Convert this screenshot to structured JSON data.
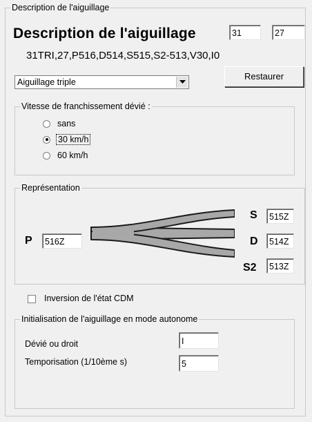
{
  "panel": {
    "legend": "Description de l'aiguillage"
  },
  "header": {
    "title": "Description de l'aiguillage",
    "field_1": "31",
    "field_2": "27",
    "code_line": "31TRI,27,P516,D514,S515,S2-513,V30,I0"
  },
  "type_select": {
    "value": "Aiguillage triple"
  },
  "restore_button": {
    "label": "Restaurer"
  },
  "speed_group": {
    "legend": "Vitesse de franchissement dévié :",
    "options": [
      {
        "label": "sans",
        "checked": false
      },
      {
        "label": "30 km/h",
        "checked": true
      },
      {
        "label": "60 km/h",
        "checked": false
      }
    ]
  },
  "representation": {
    "legend": "Représentation",
    "p_label": "P",
    "p_value": "516Z",
    "s_label": "S",
    "s_value": "515Z",
    "d_label": "D",
    "d_value": "514Z",
    "s2_label": "S2",
    "s2_value": "513Z"
  },
  "inversion": {
    "label": "Inversion de l'état CDM",
    "checked": false
  },
  "autonomous": {
    "legend": "Initialisation de l'aiguillage en mode autonome",
    "devie_label": "Dévié ou droit",
    "devie_value": "I",
    "tempo_label": "Temporisation  (1/10ème s)",
    "tempo_value": "5"
  },
  "icons": {
    "dropdown": "chevron-down-icon",
    "switch": "triple-switch-diagram"
  },
  "colors": {
    "background": "#f0f0f0",
    "track_fill": "#a8a8a8",
    "track_outline": "#1a1a1a"
  }
}
